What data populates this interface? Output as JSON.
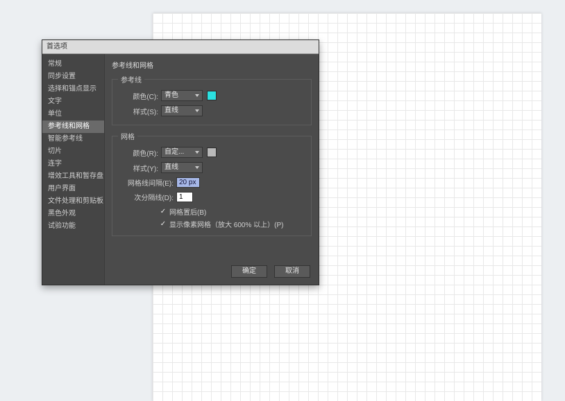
{
  "dialog": {
    "title": "首选项",
    "section_title": "参考线和网格",
    "buttons": {
      "ok": "确定",
      "cancel": "取消"
    }
  },
  "sidebar": {
    "items": [
      "常规",
      "同步设置",
      "选择和锚点显示",
      "文字",
      "单位",
      "参考线和网格",
      "智能参考线",
      "切片",
      "连字",
      "增效工具和暂存盘",
      "用户界面",
      "文件处理和剪贴板",
      "黑色外观",
      "试验功能"
    ],
    "active_index": 5
  },
  "guides": {
    "legend": "参考线",
    "color_label": "颜色(C):",
    "color_value": "青色",
    "style_label": "样式(S):",
    "style_value": "直线",
    "swatch_color": "#2be0e0"
  },
  "grid": {
    "legend": "网格",
    "color_label": "颜色(R):",
    "color_value": "自定...",
    "style_label": "样式(Y):",
    "style_value": "直线",
    "spacing_label": "网格线间隔(E):",
    "spacing_value": "20 px",
    "subdiv_label": "次分隔线(D):",
    "subdiv_value": "1",
    "cb_back": "网格置后(B)",
    "cb_pixel": "显示像素网格（放大 600% 以上）(P)",
    "swatch_color": "#b9b9b9"
  }
}
